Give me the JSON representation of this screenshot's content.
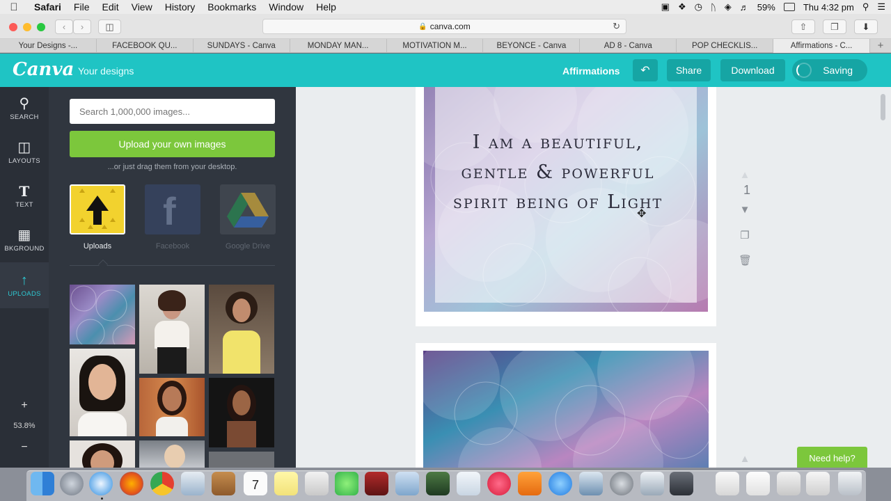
{
  "menubar": {
    "app_name": "Safari",
    "items": [
      "File",
      "Edit",
      "View",
      "History",
      "Bookmarks",
      "Window",
      "Help"
    ],
    "battery": "59%",
    "clock": "Thu 4:32 pm"
  },
  "browser": {
    "url": "canva.com",
    "tabs": [
      "Your Designs -...",
      "FACEBOOK QU...",
      "SUNDAYS - Canva",
      "MONDAY MAN...",
      "MOTIVATION M...",
      "BEYONCE - Canva",
      "AD 8 - Canva",
      "POP CHECKLIS...",
      "Affirmations - C..."
    ]
  },
  "header": {
    "logo": "Canva",
    "your_designs": "Your designs",
    "doc_title": "Affirmations",
    "share": "Share",
    "download": "Download",
    "saving": "Saving"
  },
  "nav": {
    "items": [
      {
        "label": "SEARCH",
        "icon": "search-icon"
      },
      {
        "label": "LAYOUTS",
        "icon": "layouts-icon"
      },
      {
        "label": "TEXT",
        "icon": "text-icon"
      },
      {
        "label": "BKGROUND",
        "icon": "background-icon"
      },
      {
        "label": "UPLOADS",
        "icon": "upload-icon"
      }
    ],
    "zoom": "53.8%"
  },
  "panel": {
    "search_placeholder": "Search 1,000,000 images...",
    "upload_button": "Upload your own images",
    "drag_hint": "...or just drag them from your desktop.",
    "sources": [
      "Uploads",
      "Facebook",
      "Google Drive"
    ]
  },
  "canvas": {
    "quote": "I am a beautiful, gentle & powerful spirit being of Light",
    "page_number": "1",
    "help": "Need help?"
  },
  "colors": {
    "accent": "#1fc4c4",
    "accent_dark": "#16a5a4",
    "green": "#7cc73c",
    "sidebar": "#2a2f37"
  }
}
